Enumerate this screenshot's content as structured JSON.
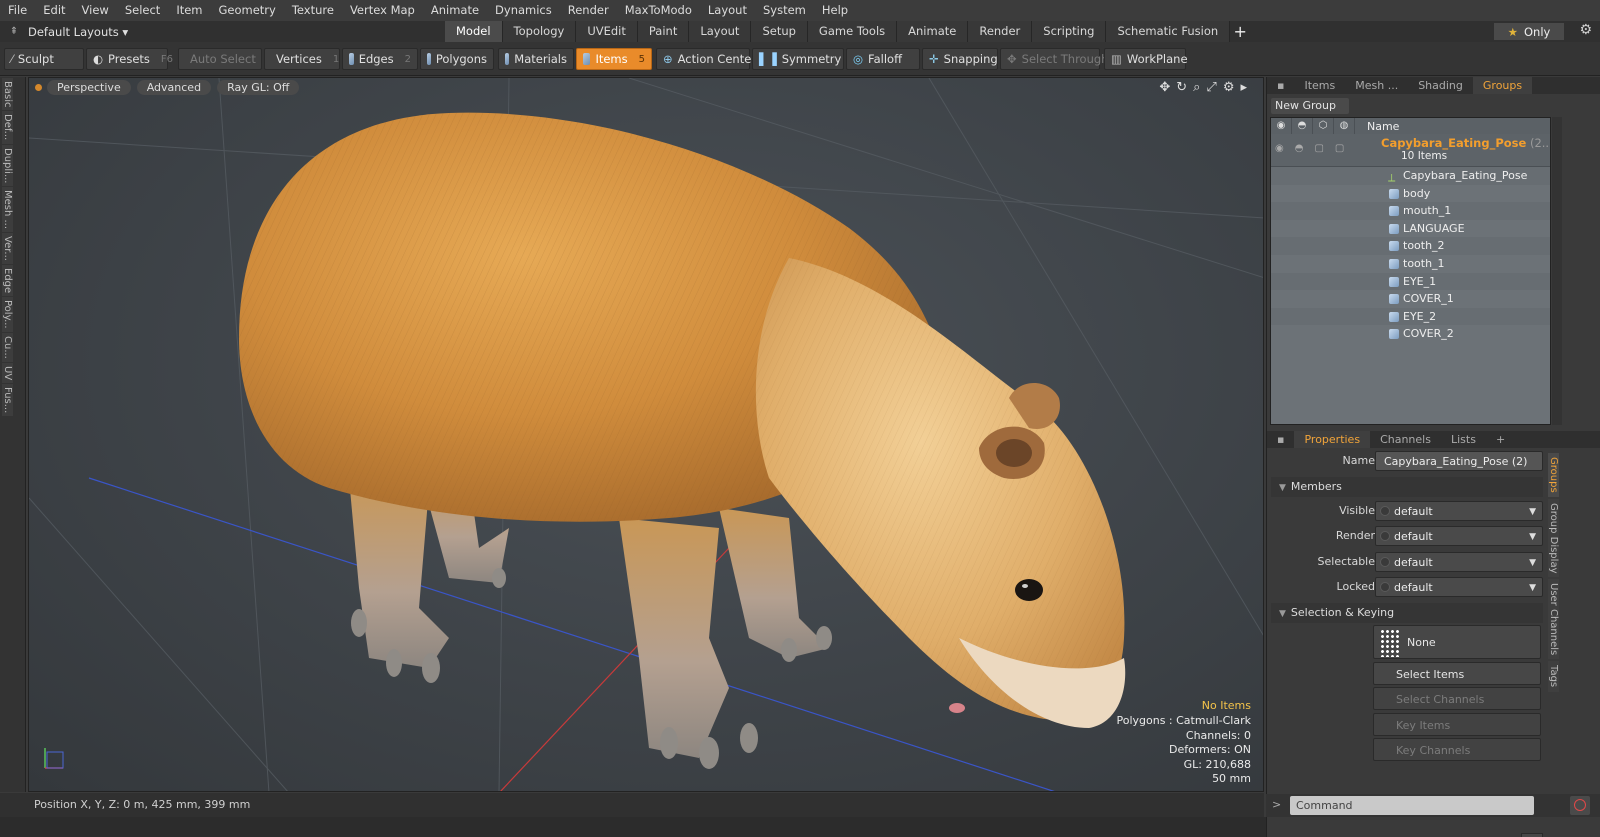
{
  "menu": [
    "File",
    "Edit",
    "View",
    "Select",
    "Item",
    "Geometry",
    "Texture",
    "Vertex Map",
    "Animate",
    "Dynamics",
    "Render",
    "MaxToModo",
    "Layout",
    "System",
    "Help"
  ],
  "layout": {
    "select_label": "Default Layouts ▾",
    "tabs": [
      "Model",
      "Topology",
      "UVEdit",
      "Paint",
      "Layout",
      "Setup",
      "Game Tools",
      "Animate",
      "Render",
      "Scripting",
      "Schematic Fusion"
    ],
    "active_tab": "Model",
    "add_tab": "+",
    "only_label": "Only"
  },
  "toolbar": {
    "sculpt": "Sculpt",
    "presets": "Presets",
    "presets_key": "F6",
    "auto_select": "Auto Select",
    "vertices": "Vertices",
    "vertices_count": "1",
    "edges": "Edges",
    "edges_count": "2",
    "polygons": "Polygons",
    "materials": "Materials",
    "items": "Items",
    "items_count": "5",
    "action_center": "Action Center",
    "symmetry": "Symmetry",
    "falloff": "Falloff",
    "snapping": "Snapping",
    "select_through": "Select Through",
    "workplane": "WorkPlane"
  },
  "left_tabs": [
    "Basic",
    "Def...",
    "Dupli...",
    "Mesh ...",
    "Ver...",
    "Edge",
    "Poly...",
    "Cu...",
    "UV",
    "Fus..."
  ],
  "viewport": {
    "view": "Perspective",
    "shading": "Advanced",
    "raygl": "Ray GL: Off",
    "stats": {
      "no_items": "No Items",
      "polygons": "Polygons : Catmull-Clark",
      "channels": "Channels: 0",
      "deformers": "Deformers: ON",
      "gl": "GL: 210,688",
      "size": "50 mm"
    }
  },
  "status": {
    "position": "Position X, Y, Z:   0 m, 425 mm, 399 mm"
  },
  "right_panel": {
    "tabs": [
      "Items",
      "Mesh ...",
      "Shading",
      "Groups"
    ],
    "active_tab": "Groups",
    "new_group": "New Group",
    "header_name": "Name",
    "group": {
      "name": "Capybara_Eating_Pose",
      "name_suffix": " (2...",
      "count": "10 Items"
    },
    "items": [
      "Capybara_Eating_Pose",
      "body",
      "mouth_1",
      "LANGUAGE",
      "tooth_2",
      "tooth_1",
      "EYE_1",
      "COVER_1",
      "EYE_2",
      "COVER_2"
    ],
    "prop_tabs": [
      "Properties",
      "Channels",
      "Lists",
      "+"
    ],
    "active_prop_tab": "Properties",
    "properties": {
      "name_label": "Name",
      "name_value": "Capybara_Eating_Pose (2)",
      "members_section": "Members",
      "visible_label": "Visible",
      "visible_value": "default",
      "render_label": "Render",
      "render_value": "default",
      "selectable_label": "Selectable",
      "selectable_value": "default",
      "locked_label": "Locked",
      "locked_value": "default",
      "selection_section": "Selection & Keying",
      "none_button": "None",
      "select_items": "Select Items",
      "select_channels": "Select Channels",
      "key_items": "Key Items",
      "key_channels": "Key Channels",
      "more": ">>"
    },
    "vertical_tabs": [
      "Groups",
      "Group Display",
      "User Channels",
      "Tags"
    ],
    "command_placeholder": "Command"
  },
  "colors": {
    "accent": "#e98b2a",
    "group_name": "#f39e2d",
    "fur": "#d9953f"
  }
}
